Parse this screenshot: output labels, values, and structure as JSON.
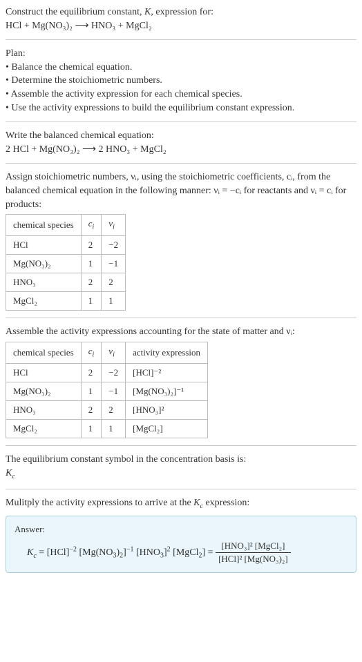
{
  "header": {
    "line1": "Construct the equilibrium constant, K, expression for:",
    "reaction_unbalanced": "HCl + Mg(NO₃)₂  ⟶  HNO₃ + MgCl₂"
  },
  "plan": {
    "title": "Plan:",
    "items": [
      "• Balance the chemical equation.",
      "• Determine the stoichiometric numbers.",
      "• Assemble the activity expression for each chemical species.",
      "• Use the activity expressions to build the equilibrium constant expression."
    ]
  },
  "balanced": {
    "title": "Write the balanced chemical equation:",
    "equation": "2 HCl + Mg(NO₃)₂  ⟶  2 HNO₃ + MgCl₂"
  },
  "assign": {
    "text": "Assign stoichiometric numbers, νᵢ, using the stoichiometric coefficients, cᵢ, from the balanced chemical equation in the following manner: νᵢ = −cᵢ for reactants and νᵢ = cᵢ for products:",
    "table": {
      "headers": [
        "chemical species",
        "cᵢ",
        "νᵢ"
      ],
      "rows": [
        [
          "HCl",
          "2",
          "−2"
        ],
        [
          "Mg(NO₃)₂",
          "1",
          "−1"
        ],
        [
          "HNO₃",
          "2",
          "2"
        ],
        [
          "MgCl₂",
          "1",
          "1"
        ]
      ]
    }
  },
  "activity": {
    "title": "Assemble the activity expressions accounting for the state of matter and νᵢ:",
    "table": {
      "headers": [
        "chemical species",
        "cᵢ",
        "νᵢ",
        "activity expression"
      ],
      "rows": [
        [
          "HCl",
          "2",
          "−2",
          "[HCl]⁻²"
        ],
        [
          "Mg(NO₃)₂",
          "1",
          "−1",
          "[Mg(NO₃)₂]⁻¹"
        ],
        [
          "HNO₃",
          "2",
          "2",
          "[HNO₃]²"
        ],
        [
          "MgCl₂",
          "1",
          "1",
          "[MgCl₂]"
        ]
      ]
    }
  },
  "symbol": {
    "line1": "The equilibrium constant symbol in the concentration basis is:",
    "line2": "K_c"
  },
  "multiply": {
    "title": "Mulitply the activity expressions to arrive at the K_c expression:"
  },
  "answer": {
    "label": "Answer:",
    "lhs": "K_c = [HCl]⁻² [Mg(NO₃)₂]⁻¹ [HNO₃]² [MgCl₂] = ",
    "num": "[HNO₃]² [MgCl₂]",
    "den": "[HCl]² [Mg(NO₃)₂]"
  },
  "chart_data": {
    "type": "table",
    "tables": [
      {
        "title": "Stoichiometric numbers",
        "headers": [
          "chemical species",
          "c_i",
          "nu_i"
        ],
        "rows": [
          {
            "species": "HCl",
            "c_i": 2,
            "nu_i": -2
          },
          {
            "species": "Mg(NO3)2",
            "c_i": 1,
            "nu_i": -1
          },
          {
            "species": "HNO3",
            "c_i": 2,
            "nu_i": 2
          },
          {
            "species": "MgCl2",
            "c_i": 1,
            "nu_i": 1
          }
        ]
      },
      {
        "title": "Activity expressions",
        "headers": [
          "chemical species",
          "c_i",
          "nu_i",
          "activity expression"
        ],
        "rows": [
          {
            "species": "HCl",
            "c_i": 2,
            "nu_i": -2,
            "activity": "[HCl]^-2"
          },
          {
            "species": "Mg(NO3)2",
            "c_i": 1,
            "nu_i": -1,
            "activity": "[Mg(NO3)2]^-1"
          },
          {
            "species": "HNO3",
            "c_i": 2,
            "nu_i": 2,
            "activity": "[HNO3]^2"
          },
          {
            "species": "MgCl2",
            "c_i": 1,
            "nu_i": 1,
            "activity": "[MgCl2]"
          }
        ]
      }
    ]
  }
}
